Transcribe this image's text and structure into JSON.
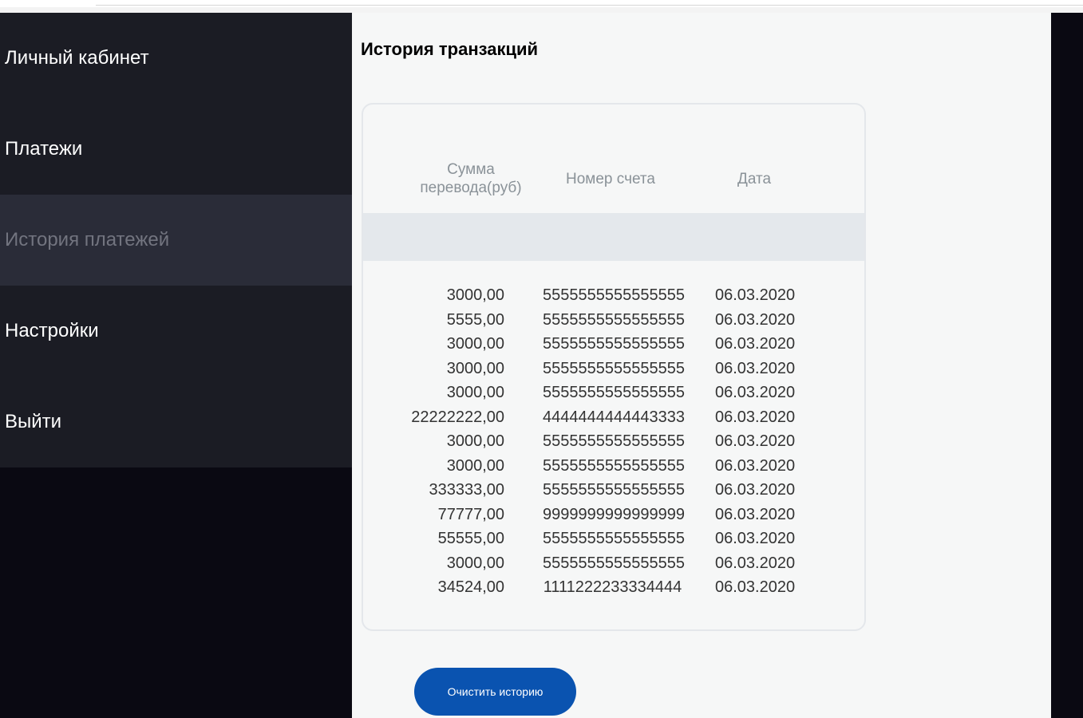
{
  "sidebar": {
    "items": [
      {
        "label": "Личный кабинет",
        "active": false
      },
      {
        "label": "Платежи",
        "active": false
      },
      {
        "label": "История платежей",
        "active": true
      },
      {
        "label": "Настройки",
        "active": false
      },
      {
        "label": "Выйти",
        "active": false
      }
    ]
  },
  "main": {
    "title": "История транзакций",
    "table": {
      "headers": {
        "amount": "Сумма перевода(руб)",
        "account": "Номер счета",
        "date": "Дата"
      },
      "rows": [
        {
          "amount": "3000,00",
          "account": "5555555555555555",
          "date": "06.03.2020"
        },
        {
          "amount": "5555,00",
          "account": "5555555555555555",
          "date": "06.03.2020"
        },
        {
          "amount": "3000,00",
          "account": "5555555555555555",
          "date": "06.03.2020"
        },
        {
          "amount": "3000,00",
          "account": "5555555555555555",
          "date": "06.03.2020"
        },
        {
          "amount": "3000,00",
          "account": "5555555555555555",
          "date": "06.03.2020"
        },
        {
          "amount": "22222222,00",
          "account": "4444444444443333",
          "date": "06.03.2020"
        },
        {
          "amount": "3000,00",
          "account": "5555555555555555",
          "date": "06.03.2020"
        },
        {
          "amount": "3000,00",
          "account": "5555555555555555",
          "date": "06.03.2020"
        },
        {
          "amount": "333333,00",
          "account": "5555555555555555",
          "date": "06.03.2020"
        },
        {
          "amount": "77777,00",
          "account": "9999999999999999",
          "date": "06.03.2020"
        },
        {
          "amount": "55555,00",
          "account": "5555555555555555",
          "date": "06.03.2020"
        },
        {
          "amount": "3000,00",
          "account": "5555555555555555",
          "date": "06.03.2020"
        },
        {
          "amount": "34524,00",
          "account": "1111222233334444",
          "date": "06.03.2020"
        }
      ]
    },
    "clear_button": "Очистить историю"
  },
  "colors": {
    "sidebar_bg": "#1b1c24",
    "sidebar_active_bg": "#2a2c38",
    "page_bg": "#0a0912",
    "content_bg": "#f6f7f7",
    "accent": "#0a53b0"
  }
}
